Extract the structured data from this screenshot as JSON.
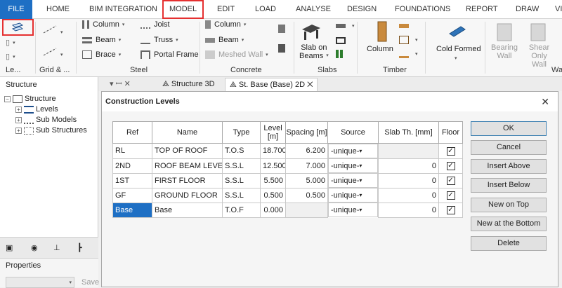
{
  "ribbon": {
    "tabs": [
      "FILE",
      "HOME",
      "BIM INTEGRATION",
      "MODEL",
      "EDIT",
      "LOAD",
      "ANALYSE",
      "DESIGN",
      "FOUNDATIONS",
      "REPORT",
      "DRAW",
      "VIEW"
    ],
    "groups": {
      "levels": "Le...",
      "grid": "Grid & ...",
      "steel": "Steel",
      "concrete": "Concrete",
      "slabs": "Slabs",
      "timber": "Timber",
      "walls": "Wal"
    },
    "steel": {
      "column": "Column",
      "beam": "Beam",
      "brace": "Brace",
      "joist": "Joist",
      "truss": "Truss",
      "portal": "Portal Frame"
    },
    "concrete": {
      "column": "Column",
      "beam": "Beam",
      "meshed_wall": "Meshed Wall"
    },
    "slabs": {
      "slab_on_beams": "Slab on\nBeams"
    },
    "timber": {
      "column": "Column"
    },
    "cold_formed": "Cold Formed",
    "walls": {
      "bearing": "Bearing Wall",
      "shear": "Shear Only Wall"
    }
  },
  "left_panel": {
    "title": "Structure",
    "tree": [
      {
        "label": "Structure",
        "level": 0
      },
      {
        "label": "Levels",
        "level": 1
      },
      {
        "label": "Sub Models",
        "level": 1
      },
      {
        "label": "Sub Structures",
        "level": 1
      }
    ],
    "properties_title": "Properties",
    "save_label": "Save"
  },
  "doc_tabs": {
    "pin": "▾ ꟷ ✕",
    "tab1": "Structure 3D",
    "tab2": "St. Base (Base) 2D",
    "tab2_close": "✕"
  },
  "dialog": {
    "title": "Construction Levels",
    "close": "✕",
    "columns": [
      "Ref",
      "Name",
      "Type",
      "Level\n[m]",
      "Spacing [m]",
      "Source",
      "Slab Th. [mm]",
      "Floor"
    ],
    "rows": [
      {
        "ref": "RL",
        "name": "TOP OF ROOF",
        "type": "T.O.S",
        "level": "18.700",
        "spacing": "6.200",
        "source": "-unique-",
        "slab": "",
        "floor": "☑"
      },
      {
        "ref": "2ND",
        "name": "ROOF BEAM LEVEL",
        "type": "S.S.L",
        "level": "12.500",
        "spacing": "7.000",
        "source": "-unique-",
        "slab": "0",
        "floor": "☑"
      },
      {
        "ref": "1ST",
        "name": "FIRST FLOOR",
        "type": "S.S.L",
        "level": "5.500",
        "spacing": "5.000",
        "source": "-unique-",
        "slab": "0",
        "floor": "☑"
      },
      {
        "ref": "GF",
        "name": "GROUND FLOOR",
        "type": "S.S.L",
        "level": "0.500",
        "spacing": "0.500",
        "source": "-unique-",
        "slab": "0",
        "floor": "☑"
      },
      {
        "ref": "Base",
        "name": "Base",
        "type": "T.O.F",
        "level": "0.000",
        "spacing": "",
        "source": "-unique-",
        "slab": "0",
        "floor": "☑"
      }
    ],
    "buttons": {
      "ok": "OK",
      "cancel": "Cancel",
      "insert_above": "Insert Above",
      "insert_below": "Insert Below",
      "new_top": "New on Top",
      "new_bottom": "New at the Bottom",
      "delete": "Delete"
    }
  },
  "colors": {
    "accent": "#1e6fc4",
    "highlight": "#e53030"
  }
}
